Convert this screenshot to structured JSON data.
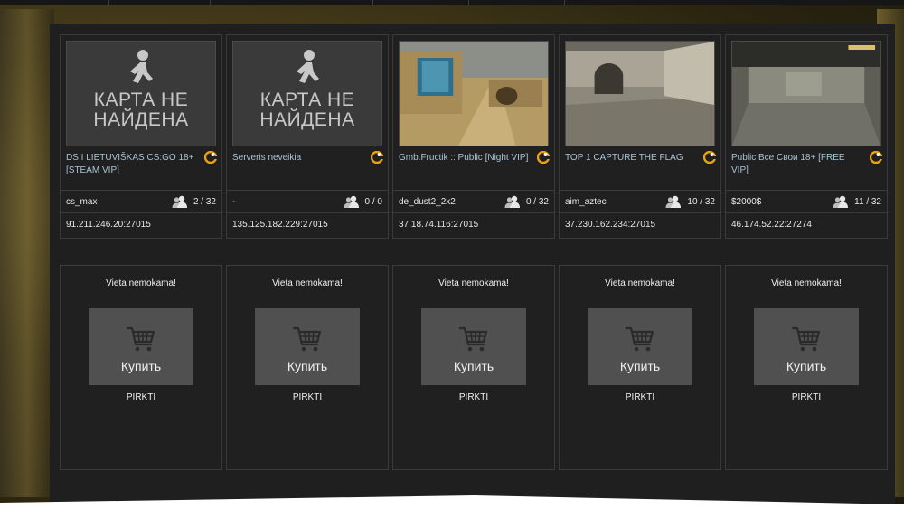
{
  "servers": [
    {
      "title": "DS I LIETUVIŠKAS CS:GO 18+ [STEAM VIP]",
      "map": "cs_max",
      "players": "2 / 32",
      "ip": "91.211.246.20:27015",
      "thumb": "notfound"
    },
    {
      "title": "Serveris neveikia",
      "map": "-",
      "players": "0 / 0",
      "ip": "135.125.182.229:27015",
      "thumb": "notfound"
    },
    {
      "title": "Gmb.Fructik :: Public [Night VIP]",
      "map": "de_dust2_2x2",
      "players": "0 / 32",
      "ip": "37.18.74.116:27015",
      "thumb": "dust"
    },
    {
      "title": "TOP 1 CAPTURE THE FLAG",
      "map": "aim_aztec",
      "players": "10 / 32",
      "ip": "37.230.162.234:27015",
      "thumb": "aztec"
    },
    {
      "title": "Public Все Свои 18+ [FREE VIP]",
      "map": "$2000$",
      "players": "11 / 32",
      "ip": "46.174.52.22:27274",
      "thumb": "room"
    }
  ],
  "map_not_found": "КАРТА НЕ НАЙДЕНА",
  "free_slots": [
    {
      "title": "Vieta nemokama!",
      "buy_label": "Купить",
      "link": "PIRKTI"
    },
    {
      "title": "Vieta nemokama!",
      "buy_label": "Купить",
      "link": "PIRKTI"
    },
    {
      "title": "Vieta nemokama!",
      "buy_label": "Купить",
      "link": "PIRKTI"
    },
    {
      "title": "Vieta nemokama!",
      "buy_label": "Купить",
      "link": "PIRKTI"
    },
    {
      "title": "Vieta nemokama!",
      "buy_label": "Купить",
      "link": "PIRKTI"
    }
  ],
  "colors": {
    "accent_title": "#a8c4d8",
    "game_icon": "#e6a317",
    "card_bg": "#202020"
  },
  "icons": {
    "game": "game-logo-icon",
    "players": "players-icon",
    "cart": "cart-icon",
    "runner": "runner-icon"
  }
}
